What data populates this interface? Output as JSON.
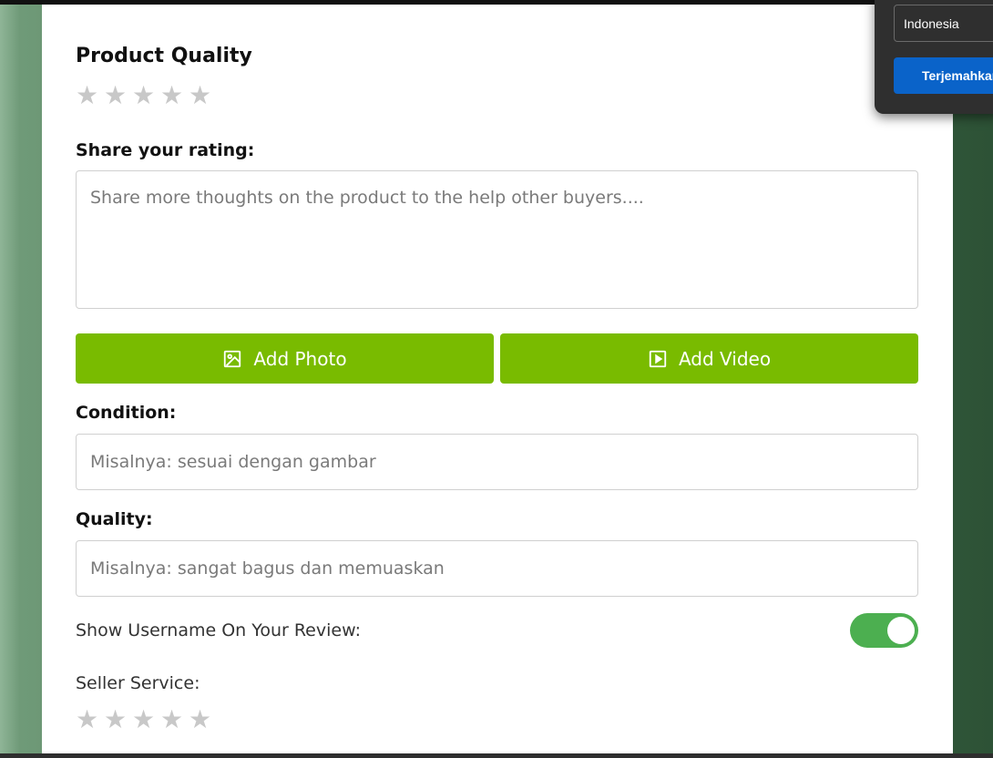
{
  "form": {
    "product_quality_title": "Product Quality",
    "product_quality_rating": 0,
    "share_rating_label": "Share your rating:",
    "share_rating_placeholder": "Share more thoughts on the product to the help other buyers....",
    "add_photo_label": "Add Photo",
    "add_video_label": "Add Video",
    "condition_label": "Condition:",
    "condition_placeholder": "Misalnya: sesuai dengan gambar",
    "quality_label": "Quality:",
    "quality_placeholder": "Misalnya: sangat bagus dan memuaskan",
    "show_username_label": "Show Username On Your Review:",
    "show_username_enabled": true,
    "seller_service_label": "Seller Service:",
    "seller_service_rating": 0,
    "star_glyph": "★"
  },
  "translate_popup": {
    "language": "Indonesia",
    "button_label": "Terjemahkan"
  },
  "colors": {
    "button_green": "#79bb00",
    "toggle_green": "#4caf50",
    "star_empty": "#c8c8c8",
    "translate_blue": "#0a63c9"
  }
}
